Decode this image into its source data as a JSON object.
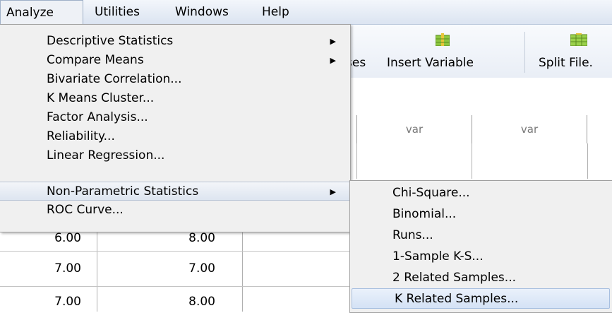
{
  "menubar": {
    "items": [
      {
        "label": "Analyze",
        "active": true
      },
      {
        "label": "Utilities"
      },
      {
        "label": "Windows"
      },
      {
        "label": "Help"
      }
    ]
  },
  "toolbar": {
    "partial_label": "ses",
    "insert_variable_label": "Insert Variable",
    "split_file_label": "Split File."
  },
  "grid": {
    "column_headers": [
      "var",
      "var"
    ],
    "rows": [
      [
        "6.00",
        "8.00"
      ],
      [
        "7.00",
        "7.00"
      ],
      [
        "7.00",
        "8.00"
      ]
    ]
  },
  "analyze_menu": {
    "items": [
      {
        "label": "Descriptive Statistics",
        "has_submenu": true
      },
      {
        "label": "Compare Means",
        "has_submenu": true
      },
      {
        "label": "Bivariate Correlation..."
      },
      {
        "label": "K Means Cluster..."
      },
      {
        "label": "Factor Analysis..."
      },
      {
        "label": "Reliability..."
      },
      {
        "label": "Linear Regression..."
      },
      {
        "label": "Non-Parametric Statistics",
        "has_submenu": true,
        "highlighted": true
      },
      {
        "label": "ROC Curve..."
      }
    ],
    "submenu_arrow": "▶"
  },
  "nonparametric_submenu": {
    "items": [
      {
        "label": "Chi-Square..."
      },
      {
        "label": "Binomial..."
      },
      {
        "label": "Runs..."
      },
      {
        "label": "1-Sample K-S..."
      },
      {
        "label": "2 Related Samples..."
      },
      {
        "label": "K Related Samples...",
        "highlighted": true
      }
    ]
  },
  "icons": {
    "insert_variable": "insert-variable-icon",
    "split_file": "split-file-icon"
  },
  "colors": {
    "menu_bg": "#f0f0f0",
    "highlight_bg": "#dde5f0",
    "icon_green": "#7fbf3f",
    "icon_yellow": "#e8c53a"
  }
}
